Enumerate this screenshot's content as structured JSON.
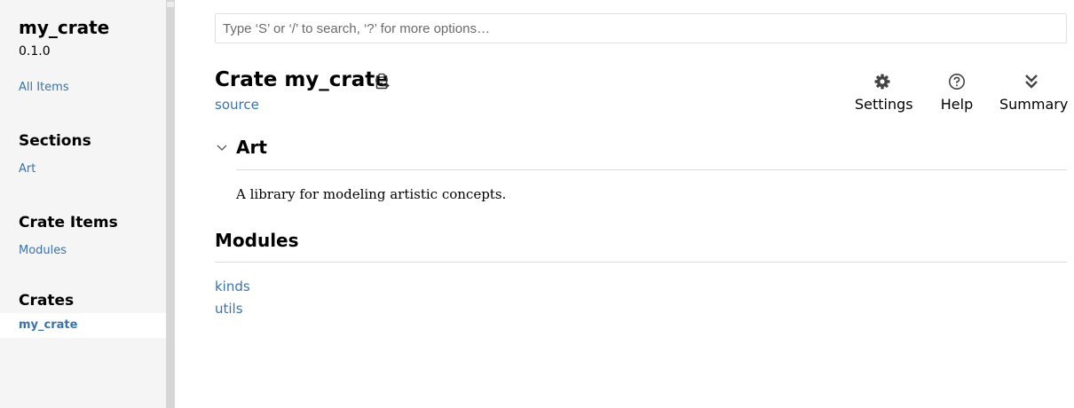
{
  "sidebar": {
    "crate_name": "my_crate",
    "version": "0.1.0",
    "all_items": "All Items",
    "sections_heading": "Sections",
    "sections": [
      "Art"
    ],
    "crate_items_heading": "Crate Items",
    "crate_items": [
      "Modules"
    ],
    "crates_heading": "Crates",
    "crates": [
      "my_crate"
    ]
  },
  "search": {
    "placeholder": "Type ‘S’ or ‘/’ to search, ‘?’ for more options…"
  },
  "main": {
    "title": "Crate my_crate",
    "source_link": "source",
    "toolbar": {
      "settings": "Settings",
      "help": "Help",
      "summary": "Summary"
    },
    "art_heading": "Art",
    "art_text": "A library for modeling artistic concepts.",
    "modules_heading": "Modules",
    "modules": [
      "kinds",
      "utils"
    ]
  },
  "colors": {
    "link": "#3873ad",
    "sidebar_bg": "#f5f5f5",
    "rule": "#dddddd"
  },
  "icons": {
    "copy": "clipboard-icon",
    "settings": "gear-icon",
    "help": "question-circle-icon",
    "summary": "double-chevron-down-icon",
    "toggle": "chevron-down-icon"
  }
}
